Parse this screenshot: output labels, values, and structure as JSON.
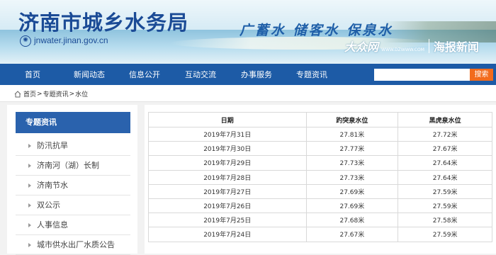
{
  "header": {
    "site_name": "济南市城乡水务局",
    "url": "jnwater.jinan.gov.cn",
    "slogan": "广蓄水 储客水 保泉水",
    "partner_logo": "大众网",
    "partner_sub": "WWW.DZWWW.COM",
    "partner_name": "海报新闻"
  },
  "nav": {
    "items": [
      "首页",
      "新闻动态",
      "信息公开",
      "互动交流",
      "办事服务",
      "专题资讯"
    ],
    "search_placeholder": "",
    "search_button": "搜索"
  },
  "breadcrumb": {
    "home_icon": "home-icon",
    "items": [
      "首页",
      "专题资讯",
      "水位"
    ],
    "separator": ">"
  },
  "sidebar": {
    "title": "专题资讯",
    "items": [
      "防汛抗旱",
      "济南河（湖）长制",
      "济南节水",
      "双公示",
      "人事信息",
      "城市供水出厂水质公告"
    ]
  },
  "table": {
    "columns": [
      "日期",
      "趵突泉水位",
      "黑虎泉水位"
    ],
    "rows": [
      [
        "2019年7月31日",
        "27.81米",
        "27.72米"
      ],
      [
        "2019年7月30日",
        "27.77米",
        "27.67米"
      ],
      [
        "2019年7月29日",
        "27.73米",
        "27.64米"
      ],
      [
        "2019年7月28日",
        "27.73米",
        "27.64米"
      ],
      [
        "2019年7月27日",
        "27.69米",
        "27.59米"
      ],
      [
        "2019年7月26日",
        "27.69米",
        "27.59米"
      ],
      [
        "2019年7月25日",
        "27.68米",
        "27.58米"
      ],
      [
        "2019年7月24日",
        "27.67米",
        "27.59米"
      ]
    ]
  },
  "colors": {
    "nav_bg": "#1d5ba6",
    "site_name": "#1b4b96",
    "search_button": "#f26b1d",
    "sidebar_head": "#2a62ad"
  }
}
